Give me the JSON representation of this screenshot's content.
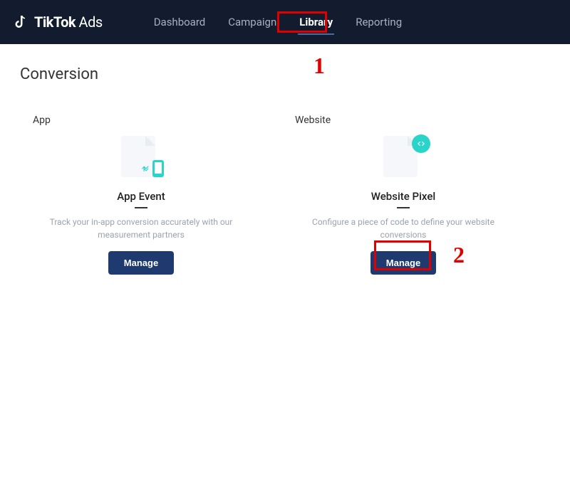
{
  "brand": {
    "name_bold": "TikTok",
    "name_light": "Ads"
  },
  "nav": {
    "dashboard": "Dashboard",
    "campaign": "Campaign",
    "library": "Library",
    "reporting": "Reporting"
  },
  "page": {
    "title": "Conversion"
  },
  "cards": {
    "app": {
      "label": "App",
      "heading": "App Event",
      "desc": "Track your in-app conversion accurately with our measurement partners",
      "button": "Manage"
    },
    "website": {
      "label": "Website",
      "heading": "Website Pixel",
      "desc": "Configure a piece of code to define your website conversions",
      "button": "Manage"
    }
  },
  "annotations": {
    "one": "1",
    "two": "2"
  }
}
